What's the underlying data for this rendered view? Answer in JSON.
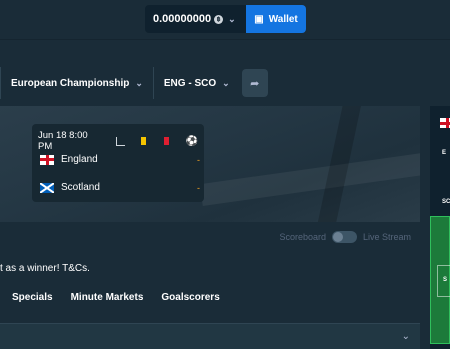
{
  "header": {
    "balance": "0.00000000",
    "currency_icon": "crypto-coin-icon",
    "wallet_label": "Wallet"
  },
  "breadcrumb": {
    "competition": "European Championship",
    "match": "ENG - SCO"
  },
  "scoreboard": {
    "datetime": "Jun 18 8:00 PM",
    "teams": [
      {
        "name": "England",
        "score": "-"
      },
      {
        "name": "Scotland",
        "score": "-"
      }
    ],
    "toggle_scoreboard": "Scoreboard",
    "toggle_livestream": "Live Stream"
  },
  "promo": {
    "text": "t as a winner!",
    "link": "T&Cs."
  },
  "tabs": [
    "Specials",
    "Minute Markets",
    "Goalscorers"
  ],
  "side_panel": {
    "team1_initial": "E",
    "team2_abbr": "SC",
    "pitch_label": "S"
  },
  "colors": {
    "accent": "#1475e1",
    "background": "#1a2c38",
    "panel": "#0f212e",
    "yellow_card": "#f5c400",
    "red_card": "#e01f31",
    "score_dash": "#f5a623"
  }
}
